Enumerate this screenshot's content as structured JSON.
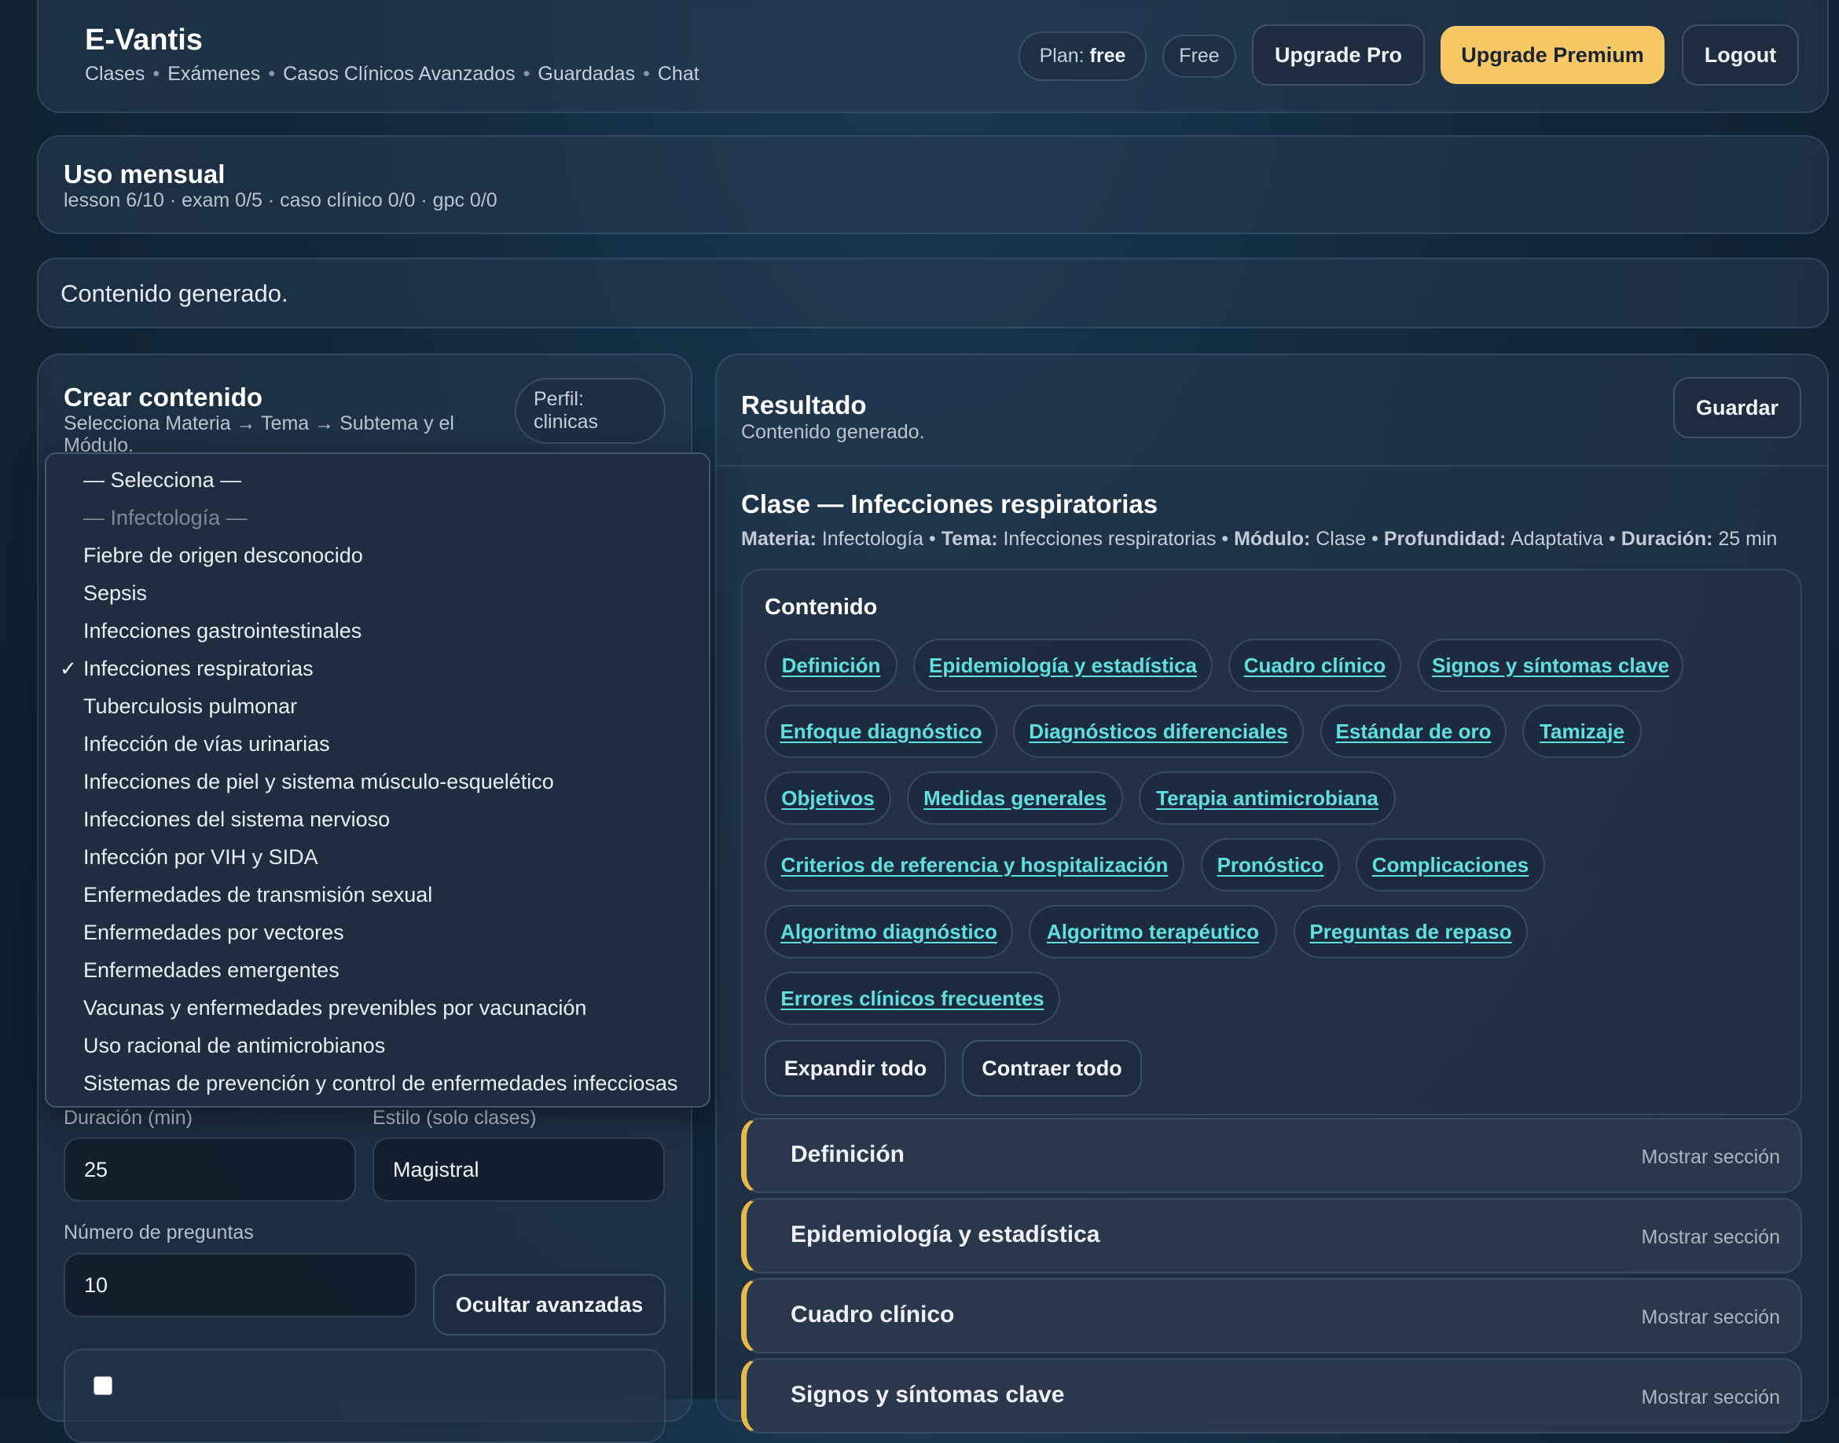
{
  "header": {
    "brand": "E-Vantis",
    "nav": [
      "Clases",
      "Exámenes",
      "Casos Clínicos Avanzados",
      "Guardadas",
      "Chat"
    ],
    "plan_prefix": "Plan:",
    "plan_value": "free",
    "plan_badge": "Free",
    "upgrade_pro": "Upgrade Pro",
    "upgrade_premium": "Upgrade Premium",
    "logout": "Logout"
  },
  "usage": {
    "title": "Uso mensual",
    "detail": "lesson 6/10 · exam 0/5 · caso clínico 0/0 · gpc 0/0"
  },
  "status": {
    "message": "Contenido generado."
  },
  "create": {
    "title": "Crear contenido",
    "subtitle_line1": "Selecciona Materia → Tema → Subtema y el",
    "subtitle_line2": "Módulo.",
    "profile_line1": "Perfil:",
    "profile_line2": "clinicas",
    "dropdown": {
      "placeholder": "— Selecciona —",
      "group_label": "— Infectología —",
      "selected_index": 3,
      "options": [
        "Fiebre de origen desconocido",
        "Sepsis",
        "Infecciones gastrointestinales",
        "Infecciones respiratorias",
        "Tuberculosis pulmonar",
        "Infección de vías urinarias",
        "Infecciones de piel y sistema músculo-esquelético",
        "Infecciones del sistema nervioso",
        "Infección por VIH y SIDA",
        "Enfermedades de transmisión sexual",
        "Enfermedades por vectores",
        "Enfermedades emergentes",
        "Vacunas y enfermedades prevenibles por vacunación",
        "Uso racional de antimicrobianos",
        "Sistemas de prevención y control de enfermedades infecciosas"
      ]
    },
    "duration_label": "Duración (min)",
    "duration_value": "25",
    "style_label": "Estilo (solo clases)",
    "style_value": "Magistral",
    "questions_label": "Número de preguntas",
    "questions_value": "10",
    "hide_advanced": "Ocultar avanzadas"
  },
  "result": {
    "title": "Resultado",
    "subtitle": "Contenido generado.",
    "save": "Guardar",
    "class_title": "Clase — Infecciones respiratorias",
    "meta": {
      "materia_label": "Materia:",
      "materia": "Infectología",
      "tema_label": "Tema:",
      "tema": "Infecciones respiratorias",
      "modulo_label": "Módulo:",
      "modulo": "Clase",
      "profundidad_label": "Profundidad:",
      "profundidad": "Adaptativa",
      "duracion_label": "Duración:",
      "duracion": "25 min"
    },
    "contents_title": "Contenido",
    "chips": [
      "Definición",
      "Epidemiología y estadística",
      "Cuadro clínico",
      "Signos y síntomas clave",
      "Enfoque diagnóstico",
      "Diagnósticos diferenciales",
      "Estándar de oro",
      "Tamizaje",
      "Objetivos",
      "Medidas generales",
      "Terapia antimicrobiana",
      "Criterios de referencia y hospitalización",
      "Pronóstico",
      "Complicaciones",
      "Algoritmo diagnóstico",
      "Algoritmo terapéutico",
      "Preguntas de repaso",
      "Errores clínicos frecuentes"
    ],
    "expand_all": "Expandir todo",
    "collapse_all": "Contraer todo",
    "sections": [
      {
        "title": "Definición",
        "action": "Mostrar sección"
      },
      {
        "title": "Epidemiología y estadística",
        "action": "Mostrar sección"
      },
      {
        "title": "Cuadro clínico",
        "action": "Mostrar sección"
      },
      {
        "title": "Signos y síntomas clave",
        "action": "Mostrar sección"
      }
    ]
  },
  "colors": {
    "accent_link": "#5fe0df",
    "premium": "#f6c865",
    "section_bar": "#e8b94a"
  }
}
